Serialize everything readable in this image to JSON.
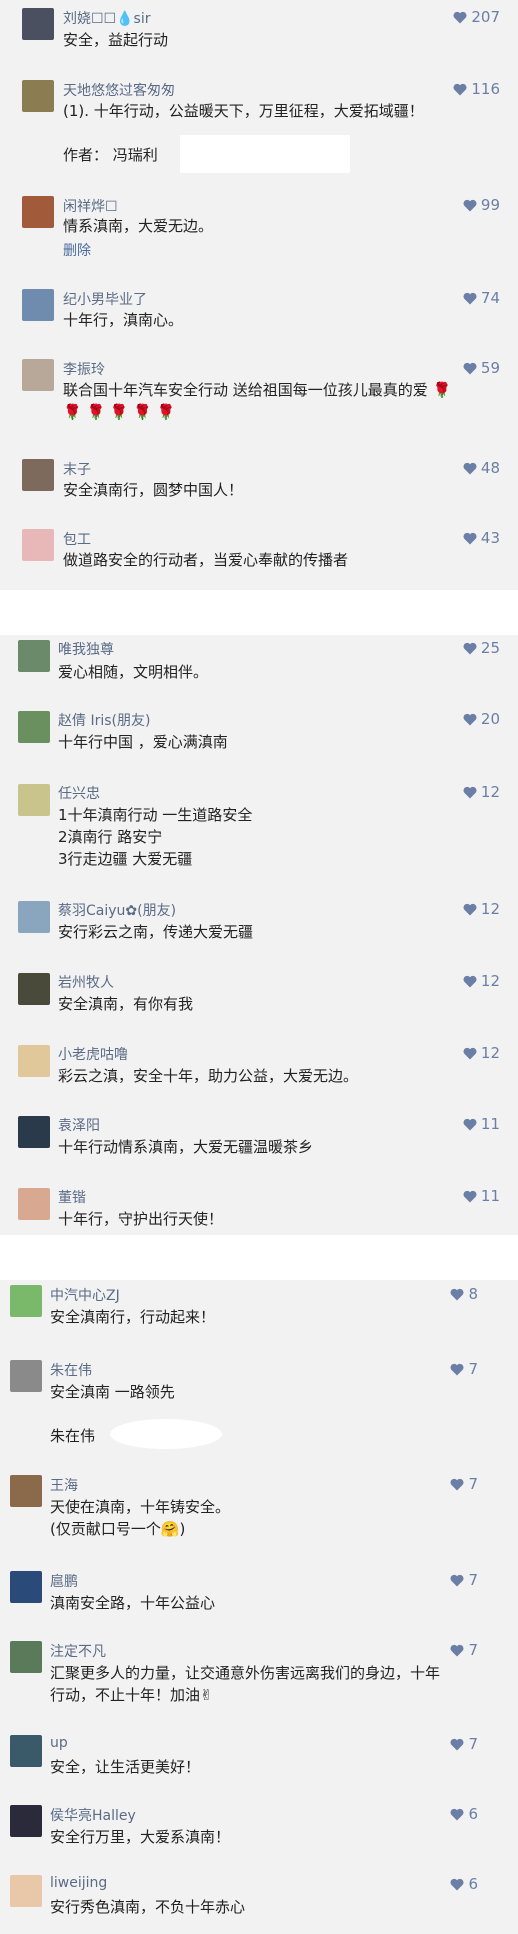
{
  "sections": [
    {
      "comments": [
        {
          "name": "刘娆𝐬𝐢𝐫",
          "display_name": "刘娆☐☐💧sir",
          "likes": "207",
          "text": "安全，益起行动",
          "avatar_color": "#4a5060"
        },
        {
          "name": "天地悠悠过客匆匆",
          "likes": "116",
          "text": "(1).  十年行动，公益暖天下，万里征程，大爱拓域疆！\n\n作者：  冯瑞利",
          "avatar_color": "#8a7d52"
        },
        {
          "name": "闲祥烨☐",
          "likes": "99",
          "text": "情系滇南，大爱无边。",
          "delete": "删除",
          "avatar_color": "#a15a3a"
        },
        {
          "name": "纪小男毕业了",
          "likes": "74",
          "text": "十年行，滇南心。",
          "avatar_color": "#6f8cae"
        },
        {
          "name": "李振玲",
          "likes": "59",
          "text": "联合国十年汽车安全行动 送给祖国每一位孩儿最真的爱 🌹\n🌹 🌹 🌹 🌹 🌹",
          "avatar_color": "#b8a89a"
        },
        {
          "name": "末子",
          "likes": "48",
          "text": "安全滇南行，圆梦中国人！",
          "avatar_color": "#7d6a5c"
        },
        {
          "name": "包工",
          "likes": "43",
          "text": "做道路安全的行动者，当爱心奉献的传播者",
          "avatar_color": "#e8b8b8"
        }
      ]
    },
    {
      "comments": [
        {
          "name": "唯我独尊",
          "likes": "25",
          "text": "爱心相随，文明相伴。",
          "avatar_color": "#6a8a6a"
        },
        {
          "name": "赵倩 Iris(朋友)",
          "likes": "20",
          "text": "十年行中国 ，爱心满滇南",
          "avatar_color": "#6a9060"
        },
        {
          "name": "任兴忠",
          "likes": "12",
          "text": "1十年滇南行动 一生道路安全\n2滇南行 路安宁\n3行走边疆 大爱无疆",
          "avatar_color": "#c8c48c"
        },
        {
          "name": "蔡羽Caiyu✿(朋友)",
          "likes": "12",
          "text": "安行彩云之南，传递大爱无疆",
          "avatar_color": "#8aa6be"
        },
        {
          "name": "岩州牧人",
          "likes": "12",
          "text": "安全滇南，有你有我",
          "avatar_color": "#4a4a3a"
        },
        {
          "name": "小老虎咕噜",
          "likes": "12",
          "text": "彩云之滇，安全十年，助力公益，大爱无边。",
          "avatar_color": "#e0c89a"
        },
        {
          "name": "袁泽阳",
          "likes": "11",
          "text": "十年行动情系滇南，大爱无疆温暖茶乡",
          "avatar_color": "#2a3a4a"
        },
        {
          "name": "董锴",
          "likes": "11",
          "text": "十年行，守护出行天使！",
          "avatar_color": "#d8a890"
        }
      ]
    },
    {
      "comments": [
        {
          "name": "中汽中心ZJ",
          "likes": "8",
          "text": "安全滇南行，行动起来！",
          "avatar_color": "#7ab86a"
        },
        {
          "name": "朱在伟",
          "likes": "7",
          "text": "安全滇南     一路领先\n\n朱在伟",
          "avatar_color": "#8a8a8a"
        },
        {
          "name": "王海",
          "likes": "7",
          "text": "天使在滇南，十年铸安全。\n(仅贡献口号一个🤗)",
          "avatar_color": "#8a6a4a"
        },
        {
          "name": "扈鹏",
          "likes": "7",
          "text": "滇南安全路，十年公益心",
          "avatar_color": "#2a4a7a"
        },
        {
          "name": "注定不凡",
          "likes": "7",
          "text": "汇聚更多人的力量，让交通意外伤害远离我们的身边，十年\n行动，不止十年！加油✌",
          "avatar_color": "#5a7a5a"
        },
        {
          "name": "up",
          "likes": "7",
          "text": "安全，让生活更美好！",
          "avatar_color": "#3a5a6a"
        },
        {
          "name": "侯华亮Halley",
          "likes": "6",
          "text": "安全行万里，大爱系滇南！",
          "avatar_color": "#2a2a3a"
        },
        {
          "name": "liweijing",
          "likes": "6",
          "text": "安行秀色滇南，不负十年赤心",
          "avatar_color": "#e8c8a8"
        }
      ]
    }
  ]
}
